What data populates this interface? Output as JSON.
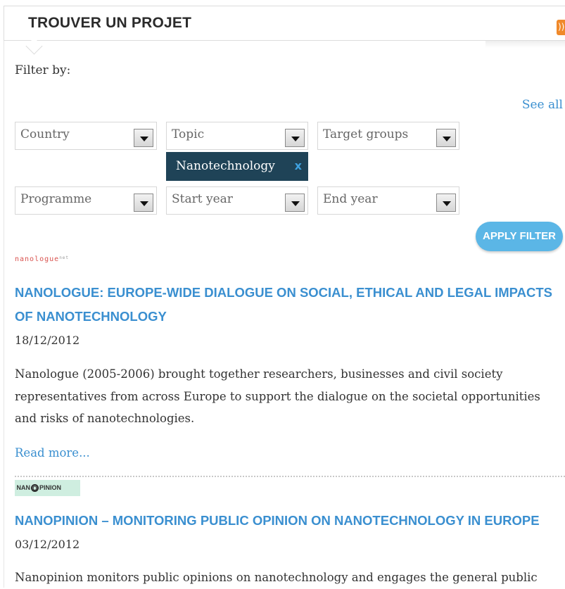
{
  "header": {
    "title": "TROUVER UN PROJET",
    "rss_icon": "rss-feed-icon"
  },
  "filters": {
    "filter_by_label": "Filter by:",
    "see_all": "See all",
    "country": "Country",
    "topic": "Topic",
    "target_groups": "Target groups",
    "programme": "Programme",
    "start_year": "Start year",
    "end_year": "End year",
    "active_chip": {
      "label": "Nanotechnology",
      "remove": "x"
    },
    "apply_button": "APPLY FILTER"
  },
  "results": [
    {
      "logo_text": "nanologue",
      "logo_sup": "net",
      "title": "NANOLOGUE: EUROPE-WIDE DIALOGUE ON SOCIAL, ETHICAL AND LEGAL IMPACTS OF NANOTECHNOLOGY",
      "date": "18/12/2012",
      "text": "Nanologue (2005-2006) brought together researchers, businesses and civil society representatives from across Europe to support the dialogue on the societal opportunities and risks of nanotechnologies.",
      "read_more": "Read more..."
    },
    {
      "logo_pre": "NAN",
      "logo_q": "O",
      "logo_post": "PINION",
      "title": "NANOPINION – MONITORING PUBLIC OPINION ON NANOTECHNOLOGY IN EUROPE",
      "date": "03/12/2012",
      "text": "Nanopinion monitors public opinions on nanotechnology and engages the general public"
    }
  ],
  "colors": {
    "link": "#3a8fd0",
    "chip_bg": "#1f4357",
    "button_bg": "#5bb6e6",
    "rss": "#f0892a"
  }
}
